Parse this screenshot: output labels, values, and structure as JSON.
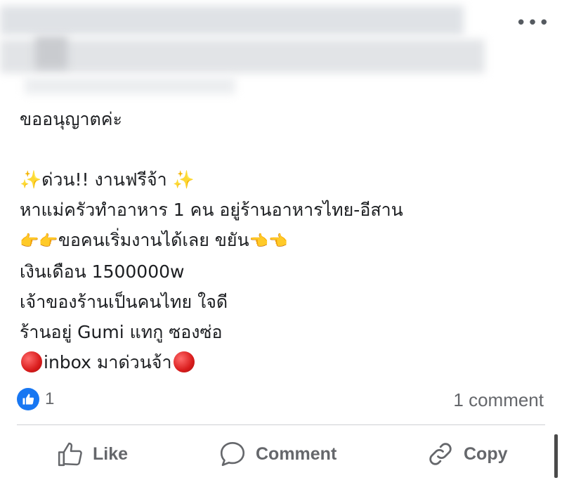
{
  "header": {
    "more_label": "•••"
  },
  "post": {
    "lines": [
      "ขออนุญาตค่ะ",
      "",
      "ด่วน!! งานฟรีจ้า",
      "หาแม่ครัวทำอาหาร 1 คน  อยู่ร้านอาหารไทย-อีสาน",
      "ขอคนเริ่มงานได้เลย ขยัน",
      "เงินเดือน 1500000w",
      "เจ้าของร้านเป็นคนไทย ใจดี",
      "ร้านอยู่ Gumi แทกู ซองซ่อ",
      "inbox มาด่วนจ้า"
    ],
    "emoji": {
      "sparkle": "✨",
      "hand_right": "👉",
      "hand_left": "👈"
    }
  },
  "reactions": {
    "like_count": "1",
    "comment_count": "1 comment"
  },
  "actions": {
    "like": "Like",
    "comment": "Comment",
    "copy": "Copy"
  },
  "colors": {
    "accent": "#1877f2",
    "muted": "#65676b",
    "text": "#1c1e21"
  }
}
